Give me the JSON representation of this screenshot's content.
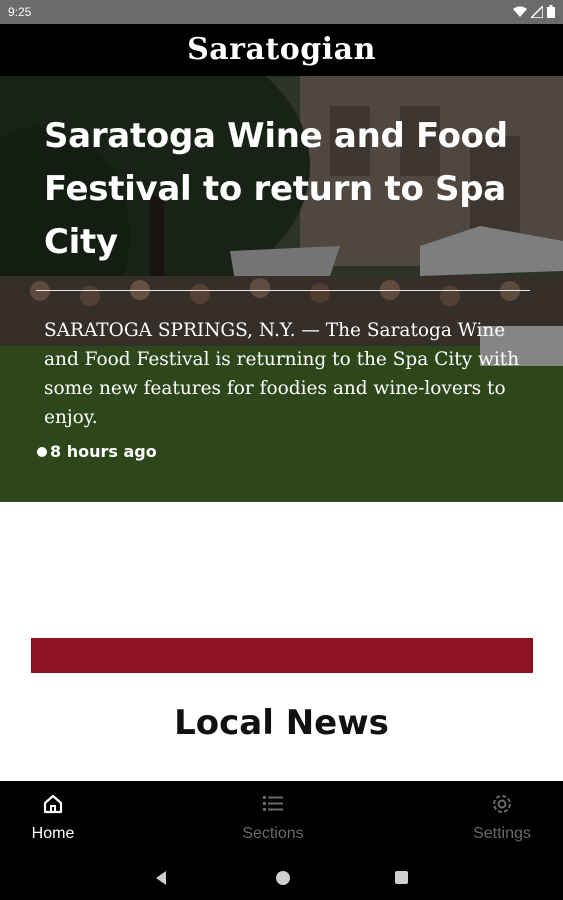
{
  "status_bar": {
    "time": "9:25"
  },
  "header": {
    "logo": "Saratogian"
  },
  "hero": {
    "title": "Saratoga Wine and Food Festival to return to Spa City",
    "summary": "SARATOGA SPRINGS, N.Y. — The Saratoga Wine and Food Festival is returning to the Spa City with some new features for foodies and wine-lovers to enjoy.",
    "time": "8 hours ago"
  },
  "section": {
    "title": "Local News",
    "accent_color": "#8e1321"
  },
  "bottom_nav": {
    "items": [
      {
        "label": "Home",
        "icon": "home-icon",
        "active": true
      },
      {
        "label": "Sections",
        "icon": "list-icon",
        "active": false
      },
      {
        "label": "Settings",
        "icon": "gear-icon",
        "active": false
      }
    ]
  }
}
